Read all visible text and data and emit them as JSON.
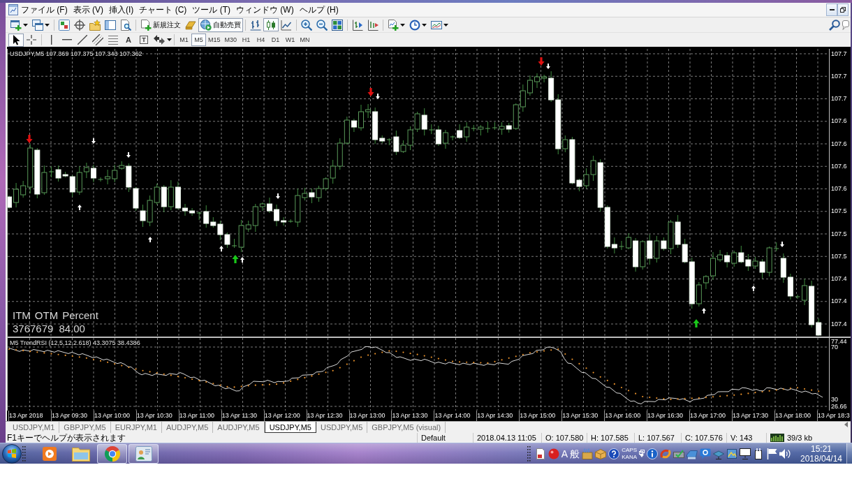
{
  "menu": {
    "items": [
      "ファイル (F)",
      "表示 (V)",
      "挿入(I)",
      "チャート (C)",
      "ツール (T)",
      "ウィンドウ (W)",
      "ヘルプ (H)"
    ]
  },
  "toolbar": {
    "new_order": {
      "label": "新規注文"
    },
    "auto_trading": {
      "label": "自動売買",
      "on": true
    },
    "chart_types": [
      {
        "kind": "bars",
        "selected": false
      },
      {
        "kind": "candles",
        "selected": true
      },
      {
        "kind": "line",
        "selected": false
      }
    ]
  },
  "drawing_tools": [
    {
      "kind": "cursor",
      "selected": true
    },
    {
      "kind": "crosshair",
      "selected": false
    },
    {
      "kind": "vertical-line",
      "selected": false
    },
    {
      "kind": "horizontal-line",
      "selected": false
    },
    {
      "kind": "trend-line",
      "selected": false
    },
    {
      "kind": "channel",
      "selected": false
    },
    {
      "kind": "fibonacci",
      "selected": false
    },
    {
      "kind": "text",
      "glyph": "A",
      "selected": false
    },
    {
      "kind": "label",
      "glyph": "T",
      "selected": false
    },
    {
      "kind": "arrows",
      "selected": false
    }
  ],
  "timeframes": [
    {
      "label": "M1",
      "selected": false
    },
    {
      "label": "M5",
      "selected": true
    },
    {
      "label": "M15",
      "selected": false
    },
    {
      "label": "M30",
      "selected": false
    },
    {
      "label": "H1",
      "selected": false
    },
    {
      "label": "H4",
      "selected": false
    },
    {
      "label": "D1",
      "selected": false
    },
    {
      "label": "W1",
      "selected": false
    },
    {
      "label": "MN",
      "selected": false
    }
  ],
  "chart": {
    "title": "USDJPY,M5 107.369 107.375 107.343 107.362",
    "stats": {
      "headers": [
        "ITM",
        "OTM",
        "Percent"
      ],
      "values": [
        "3767679",
        "84.00"
      ]
    },
    "price_axis": [
      "107.7",
      "107.7",
      "107.7",
      "107.6",
      "107.6",
      "107.6",
      "107.6",
      "107.5",
      "107.5",
      "107.5",
      "107.4",
      "107.4",
      "107.4"
    ],
    "indicator": {
      "title": "M5 TrendRSI (12,5,12,2.618) 43.3075 38.4386",
      "axis": {
        "max": "77.44",
        "upper": "70",
        "lower": "30",
        "min": "26.66"
      }
    },
    "time_axis": [
      "13 Apr 2018",
      "13 Apr 09:30",
      "13 Apr 10:00",
      "13 Apr 10:30",
      "13 Apr 11:00",
      "13 Apr 11:30",
      "13 Apr 12:00",
      "13 Apr 12:30",
      "13 Apr 13:00",
      "13 Apr 13:30",
      "13 Apr 14:00",
      "13 Apr 14:30",
      "13 Apr 15:00",
      "13 Apr 15:30",
      "13 Apr 16:00",
      "13 Apr 16:30",
      "13 Apr 17:00",
      "13 Apr 17:30",
      "13 Apr 18:00",
      "13 Apr 18:3"
    ]
  },
  "tabs": [
    {
      "label": "USDJPY,M1",
      "selected": false
    },
    {
      "label": "GBPJPY,M5",
      "selected": false
    },
    {
      "label": "EURJPY,M1",
      "selected": false
    },
    {
      "label": "AUDJPY,M5",
      "selected": false
    },
    {
      "label": "AUDJPY,M5",
      "selected": false
    },
    {
      "label": "USDJPY,M5",
      "selected": true
    },
    {
      "label": "USDJPY,M5",
      "selected": false
    },
    {
      "label": "GBPJPY,M5 (visual)",
      "selected": false
    }
  ],
  "status_bar": {
    "help": "F1キーでヘルプが表示されます",
    "profile": "Default",
    "time": "2018.04.13 11:05",
    "open": "O: 107.580",
    "high": "H: 107.585",
    "low": "L: 107.567",
    "close": "C: 107.576",
    "volume": "V: 143",
    "traffic": "39/3 kb"
  },
  "taskbar": {
    "apps": [
      {
        "kind": "player",
        "running": false
      },
      {
        "kind": "folder",
        "running": false
      },
      {
        "kind": "browser",
        "running": true
      },
      {
        "kind": "trading",
        "running": true
      }
    ],
    "ime": {
      "mode": "A",
      "script": "般",
      "caps": "CAPS",
      "kana": "KANA"
    },
    "clock": {
      "time": "15:21",
      "date": "2018/04/14"
    }
  }
}
